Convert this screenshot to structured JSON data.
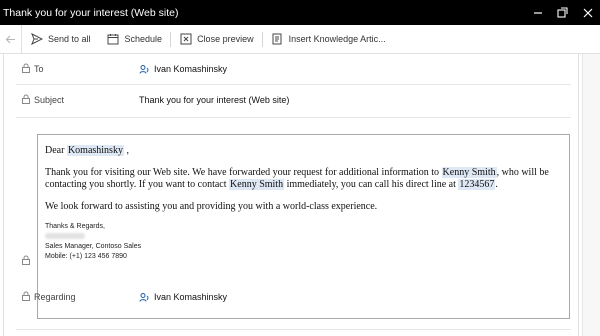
{
  "window": {
    "title": "Thank you for your interest (Web site)"
  },
  "toolbar": {
    "send_to_all": "Send to all",
    "schedule": "Schedule",
    "close_preview": "Close preview",
    "insert_ka": "Insert Knowledge Artic..."
  },
  "fields": {
    "to_label": "To",
    "to_value": "Ivan Komashinsky",
    "subject_label": "Subject",
    "subject_value": "Thank you for your interest (Web site)",
    "regarding_label": "Regarding",
    "regarding_value": "Ivan Komashinsky"
  },
  "email": {
    "greeting": "Dear",
    "greeting_name": "Komashinsky",
    "greeting_suffix": " ,",
    "p1_a": "Thank you for visiting our Web site. We have forwarded your request for additional information to ",
    "p1_name1": "Kenny Smith",
    "p1_b": ", who will be contacting you shortly. If you want to contact ",
    "p1_name2": "Kenny Smith",
    "p1_c": " immediately, you can call his  direct line at ",
    "p1_phone": "1234567",
    "p1_d": ".",
    "p2": "We look forward to assisting you and providing you with a world-class experience.",
    "sig_closing": "Thanks & Regards,",
    "sig_title": "Sales Manager, Contoso Sales",
    "sig_mobile": "Mobile: (+1) 123 456 7890"
  }
}
